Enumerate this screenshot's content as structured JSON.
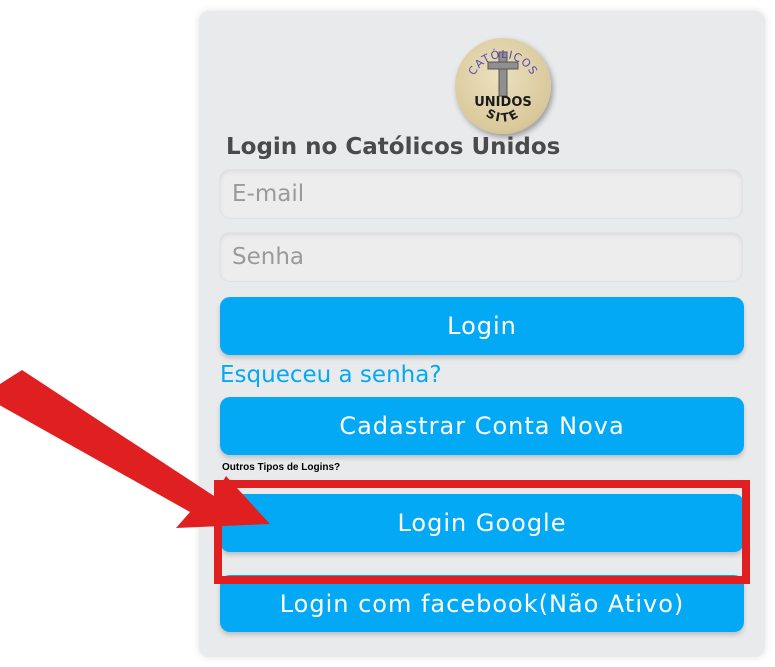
{
  "logo": {
    "arc_text": "CATÓLICOS",
    "middle_text": "UNIDOS",
    "bottom_text": "SITE"
  },
  "title": "Login no Católicos Unidos",
  "email": {
    "placeholder": "E-mail"
  },
  "password": {
    "placeholder": "Senha"
  },
  "login_button": "Login",
  "forgot_link": "Esqueceu a senha?",
  "register_button": "Cadastrar Conta Nova",
  "other_logins_label": "Outros Tipos de Logins?",
  "google_button": "Login Google",
  "facebook_button": "Login com facebook(Não Ativo)",
  "colors": {
    "accent": "#03a9f4",
    "annotation": "#e02020",
    "card_bg": "#e9eaec"
  }
}
